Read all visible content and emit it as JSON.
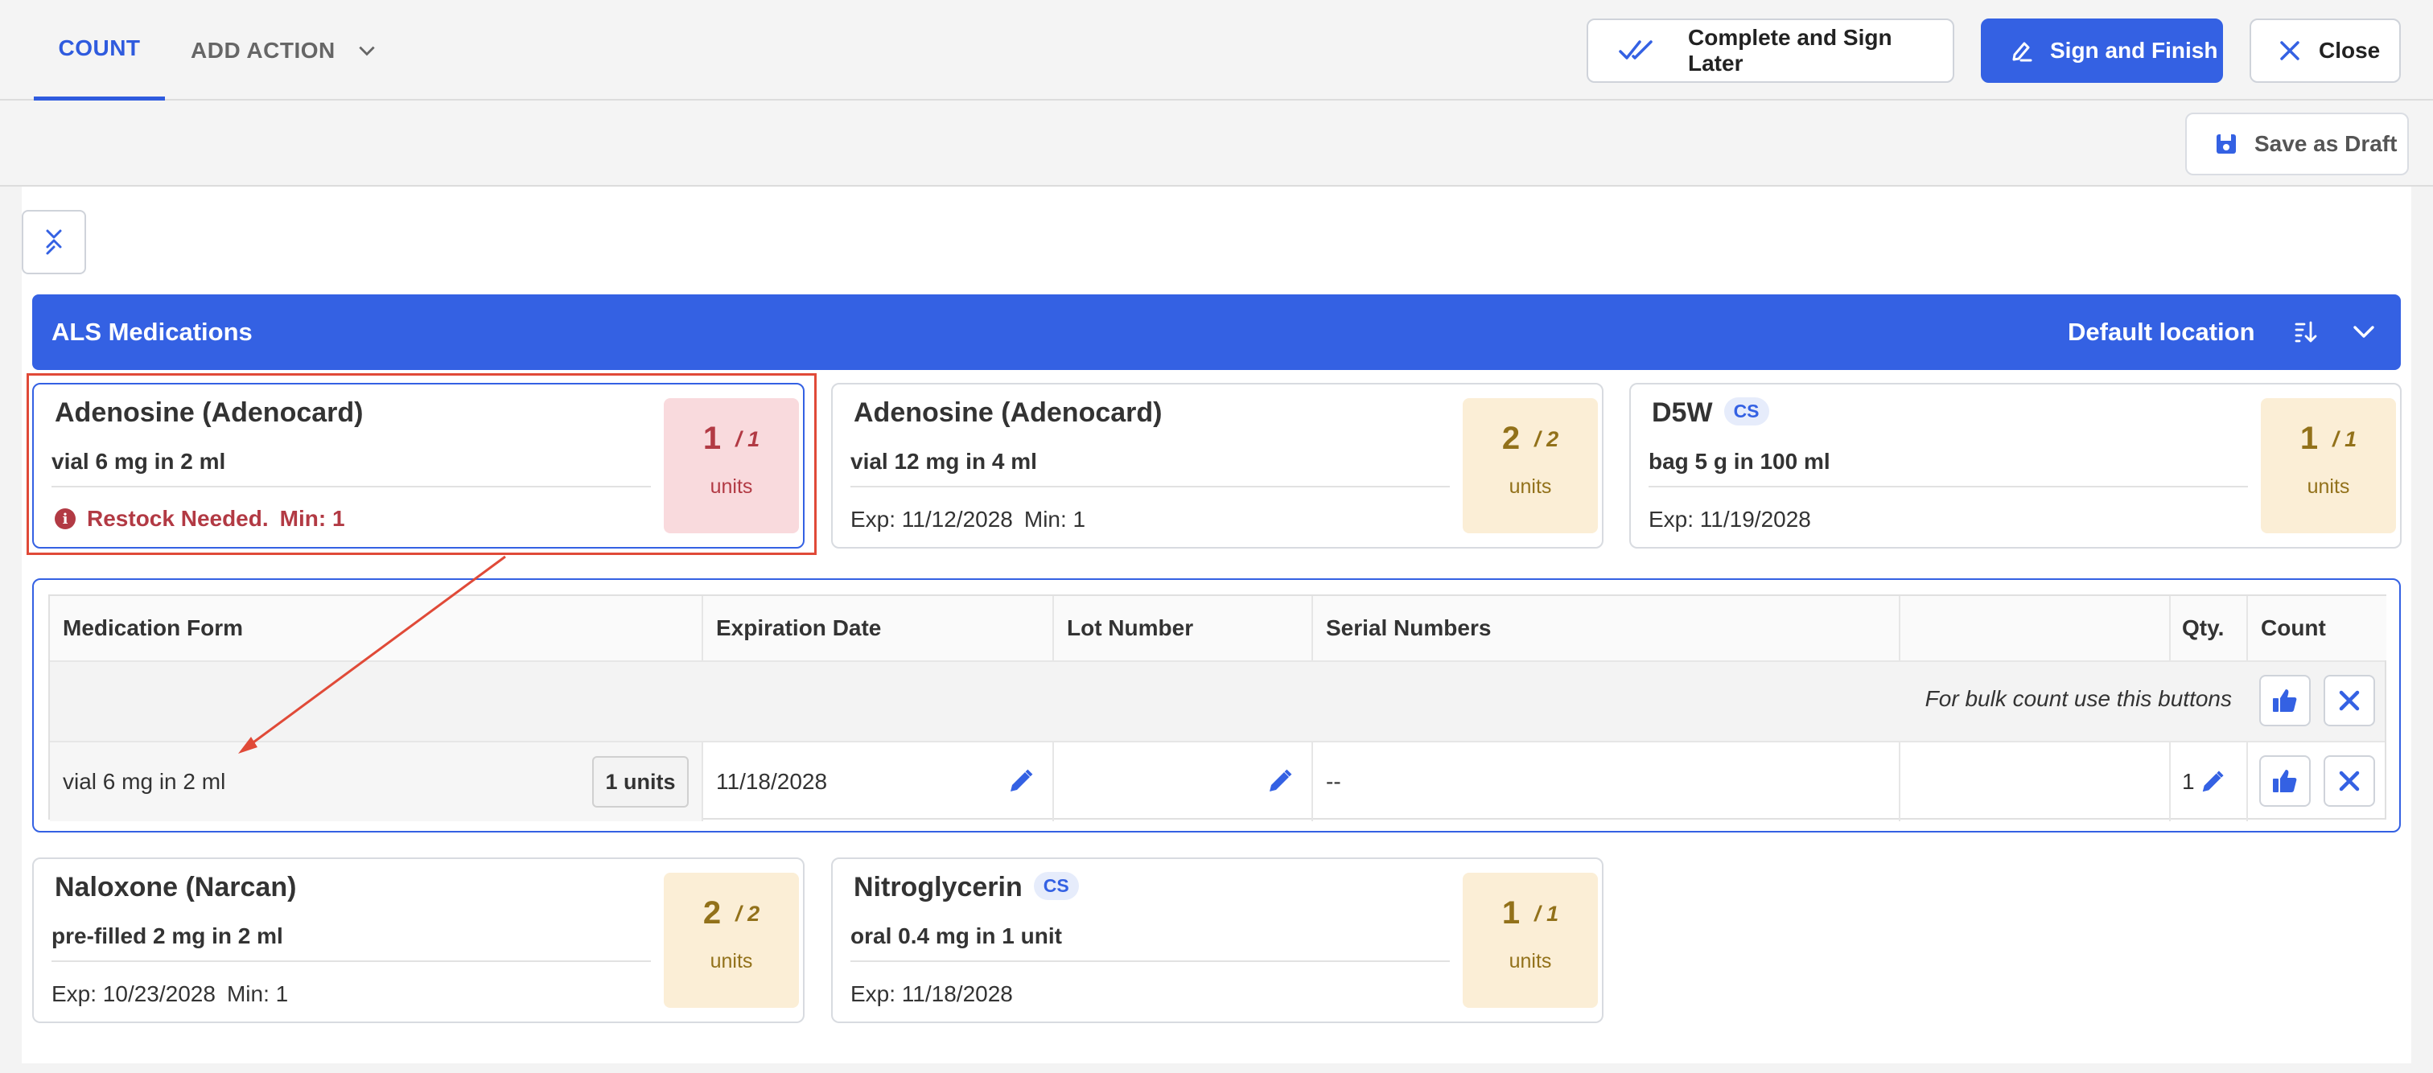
{
  "tabs": {
    "count": "COUNT",
    "add_action": "ADD ACTION"
  },
  "actions": {
    "complete_later": "Complete and Sign Later",
    "sign_finish": "Sign and Finish",
    "close": "Close",
    "save_draft": "Save as Draft"
  },
  "group": {
    "title": "ALS Medications",
    "location": "Default location"
  },
  "cards": [
    {
      "name": "Adenosine (Adenocard)",
      "form": "vial 6 mg in 2 ml",
      "status": "Restock Needed.",
      "min": "Min: 1",
      "qty": "1",
      "total": "/ 1",
      "unit": "units"
    },
    {
      "name": "Adenosine (Adenocard)",
      "form": "vial 12 mg in 4 ml",
      "exp": "Exp: 11/12/2028",
      "min": "Min: 1",
      "qty": "2",
      "total": "/ 2",
      "unit": "units"
    },
    {
      "name": "D5W",
      "badge": "CS",
      "form": "bag 5 g in 100 ml",
      "exp": "Exp: 11/19/2028",
      "qty": "1",
      "total": "/ 1",
      "unit": "units"
    },
    {
      "name": "Naloxone (Narcan)",
      "form": "pre-filled 2 mg in 2 ml",
      "exp": "Exp: 10/23/2028",
      "min": "Min: 1",
      "qty": "2",
      "total": "/ 2",
      "unit": "units"
    },
    {
      "name": "Nitroglycerin",
      "badge": "CS",
      "form": "oral 0.4 mg in 1 unit",
      "exp": "Exp: 11/18/2028",
      "qty": "1",
      "total": "/ 1",
      "unit": "units"
    }
  ],
  "detail": {
    "headers": {
      "form": "Medication Form",
      "exp": "Expiration Date",
      "lot": "Lot Number",
      "serial": "Serial Numbers",
      "qty": "Qty.",
      "count": "Count"
    },
    "bulk_hint": "For bulk count use this buttons",
    "row": {
      "form": "vial 6 mg in 2 ml",
      "units": "1 units",
      "exp": "11/18/2028",
      "serial": "--",
      "qty": "1"
    }
  },
  "colors": {
    "primary": "#3461e3",
    "alert": "#b23a44",
    "highlight": "#e04a38",
    "qty_bg": "#fbeed6"
  }
}
